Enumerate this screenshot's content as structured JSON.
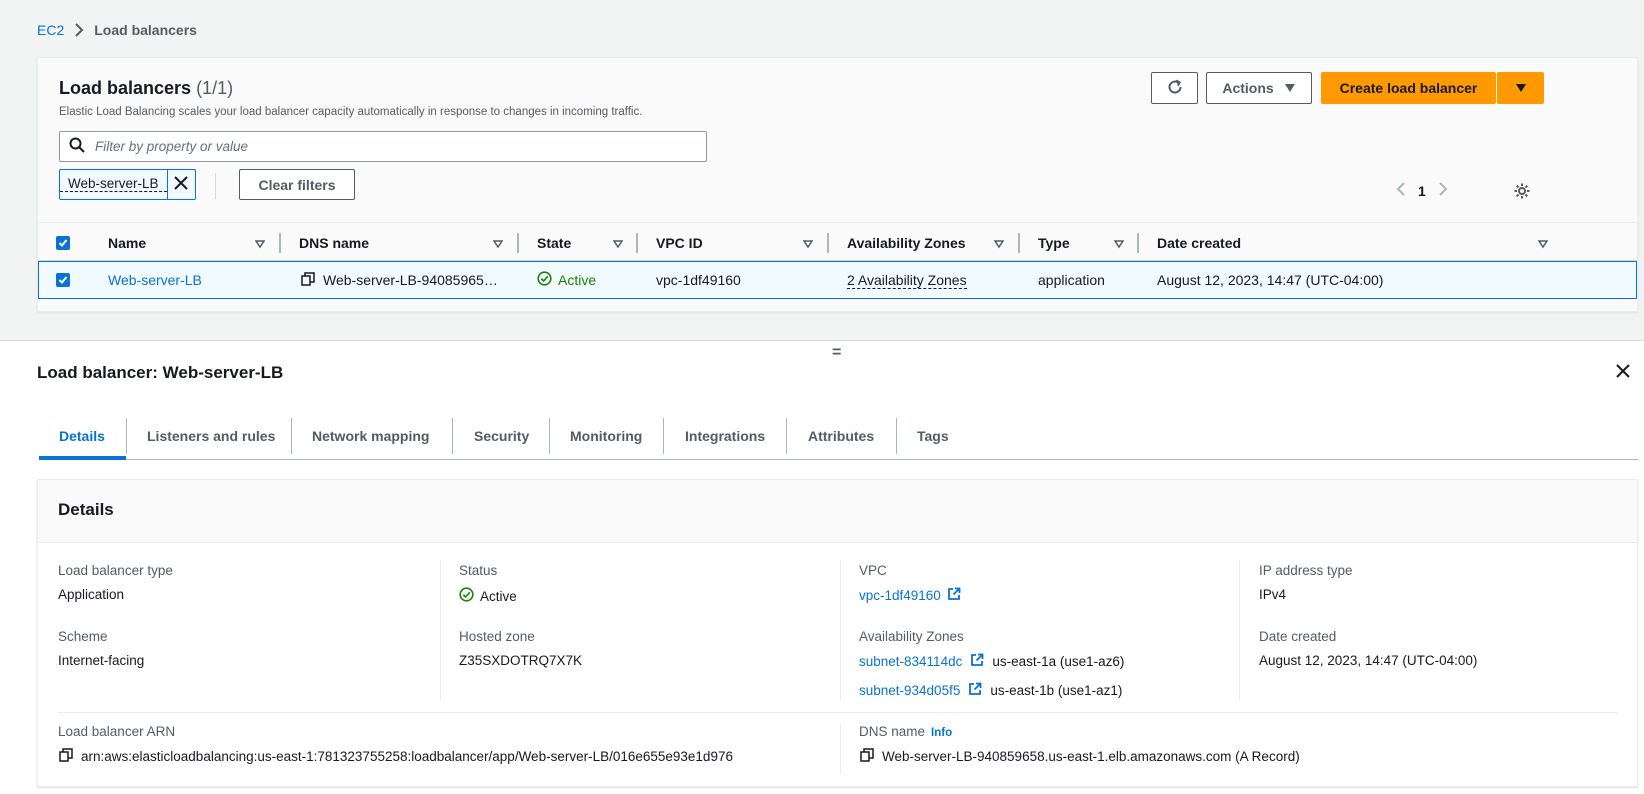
{
  "breadcrumb": {
    "root": "EC2",
    "current": "Load balancers"
  },
  "panel": {
    "title": "Load balancers",
    "count": "(1/1)",
    "description": "Elastic Load Balancing scales your load balancer capacity automatically in response to changes in incoming traffic.",
    "refresh_icon": "refresh-icon",
    "actions_label": "Actions",
    "create_label": "Create load balancer"
  },
  "filter": {
    "placeholder": "Filter by property or value",
    "token": "Web-server-LB",
    "clear_label": "Clear filters"
  },
  "pagination": {
    "page": "1"
  },
  "table": {
    "headers": {
      "name": "Name",
      "dns": "DNS name",
      "state": "State",
      "vpc": "VPC ID",
      "az": "Availability Zones",
      "type": "Type",
      "date": "Date created"
    },
    "rows": [
      {
        "name": "Web-server-LB",
        "dns": "Web-server-LB-94085965…",
        "state": "Active",
        "vpc": "vpc-1df49160",
        "az": "2 Availability Zones",
        "type": "application",
        "date": "August 12, 2023, 14:47 (UTC-04:00)"
      }
    ]
  },
  "split_handle": "=",
  "detail": {
    "title": "Load balancer: Web-server-LB",
    "tabs": [
      "Details",
      "Listeners and rules",
      "Network mapping",
      "Security",
      "Monitoring",
      "Integrations",
      "Attributes",
      "Tags"
    ],
    "card_title": "Details",
    "lb_type_label": "Load balancer type",
    "lb_type_value": "Application",
    "status_label": "Status",
    "status_value": "Active",
    "vpc_label": "VPC",
    "vpc_value": "vpc-1df49160",
    "ip_label": "IP address type",
    "ip_value": "IPv4",
    "scheme_label": "Scheme",
    "scheme_value": "Internet-facing",
    "hosted_label": "Hosted zone",
    "hosted_value": "Z35SXDOTRQ7X7K",
    "az_label": "Availability Zones",
    "subnets": [
      {
        "id": "subnet-834114dc",
        "zone": "us-east-1a (use1-az6)"
      },
      {
        "id": "subnet-934d05f5",
        "zone": "us-east-1b (use1-az1)"
      }
    ],
    "date_label": "Date created",
    "date_value": "August 12, 2023, 14:47 (UTC-04:00)",
    "arn_label": "Load balancer ARN",
    "arn_value": "arn:aws:elasticloadbalancing:us-east-1:781323755258:loadbalancer/app/Web-server-LB/016e655e93e1d976",
    "dns_label": "DNS name",
    "dns_info": "Info",
    "dns_value": "Web-server-LB-940859658.us-east-1.elb.amazonaws.com (A Record)"
  },
  "colors": {
    "accent": "#0972d3",
    "primary_button": "#ff9900",
    "success": "#1d8102"
  }
}
